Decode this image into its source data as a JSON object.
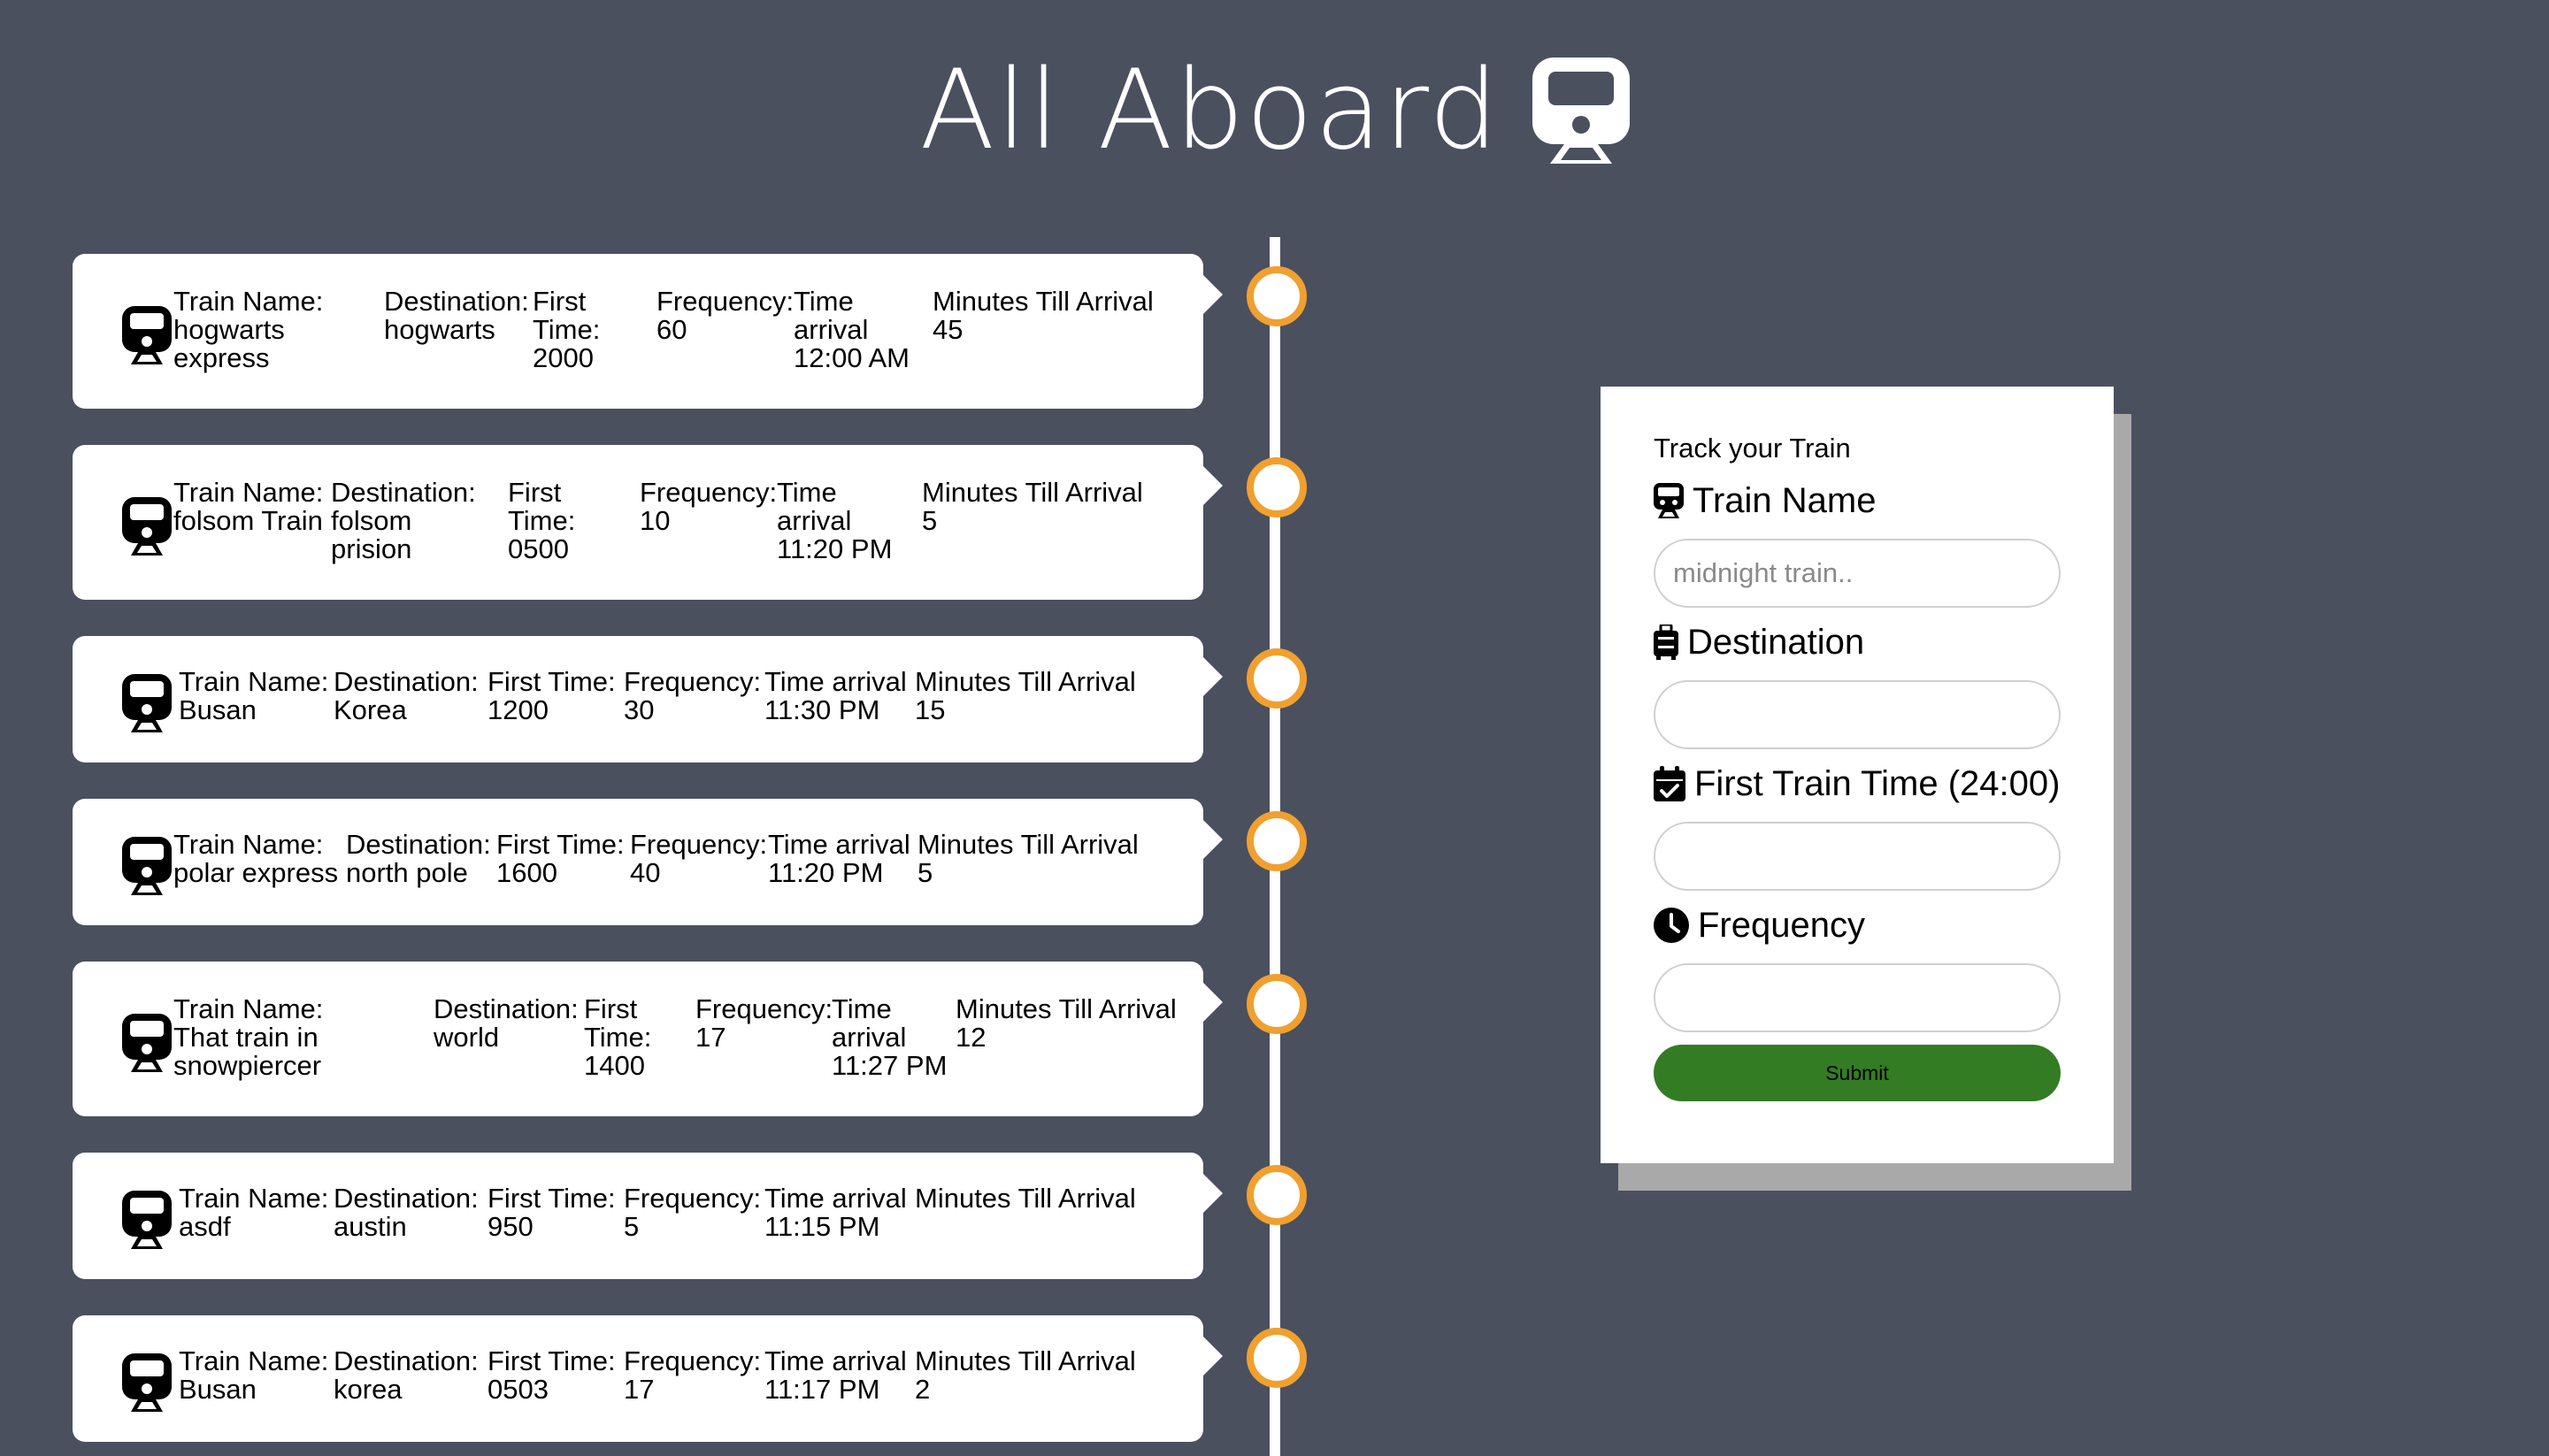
{
  "header": {
    "title": "All Aboard"
  },
  "columns": {
    "name": "Train Name:",
    "destination": "Destination:",
    "first_time": "First Time:",
    "frequency": "Frequency:",
    "arrival": "Time arrival",
    "minutes": "Minutes Till Arrival"
  },
  "trains": [
    {
      "name": "hogwarts express",
      "destination": "hogwarts",
      "first_time": "2000",
      "frequency": "60",
      "arrival": "12:00 AM",
      "minutes": "45"
    },
    {
      "name": "folsom Train",
      "destination": "folsom prision",
      "first_time": "0500",
      "frequency": "10",
      "arrival": "11:20 PM",
      "minutes": "5"
    },
    {
      "name": "Busan",
      "destination": "Korea",
      "first_time": "1200",
      "frequency": "30",
      "arrival": "11:30 PM",
      "minutes": "15"
    },
    {
      "name": "polar express",
      "destination": "north pole",
      "first_time": "1600",
      "frequency": "40",
      "arrival": "11:20 PM",
      "minutes": "5"
    },
    {
      "name": "That train in snowpiercer",
      "destination": "world",
      "first_time": "1400",
      "frequency": "17",
      "arrival": "11:27 PM",
      "minutes": "12"
    },
    {
      "name": "asdf",
      "destination": "austin",
      "first_time": "950",
      "frequency": "5",
      "arrival": "11:15 PM",
      "minutes": ""
    },
    {
      "name": "Busan",
      "destination": "korea",
      "first_time": "0503",
      "frequency": "17",
      "arrival": "11:17 PM",
      "minutes": "2"
    }
  ],
  "form": {
    "heading": "Track your Train",
    "train_name_label": "Train Name",
    "train_name_placeholder": "midnight train..",
    "destination_label": "Destination",
    "first_time_label": "First Train Time (24:00)",
    "frequency_label": "Frequency",
    "submit_label": "Submit"
  },
  "icons": {
    "title": "train-icon",
    "card": "train-icon",
    "train_name": "subway-icon",
    "destination": "suitcase-icon",
    "first_time": "calendar-check-icon",
    "frequency": "clock-icon"
  },
  "colors": {
    "background": "#4a505e",
    "timeline_ring": "#f0a030",
    "submit": "#347c23"
  }
}
